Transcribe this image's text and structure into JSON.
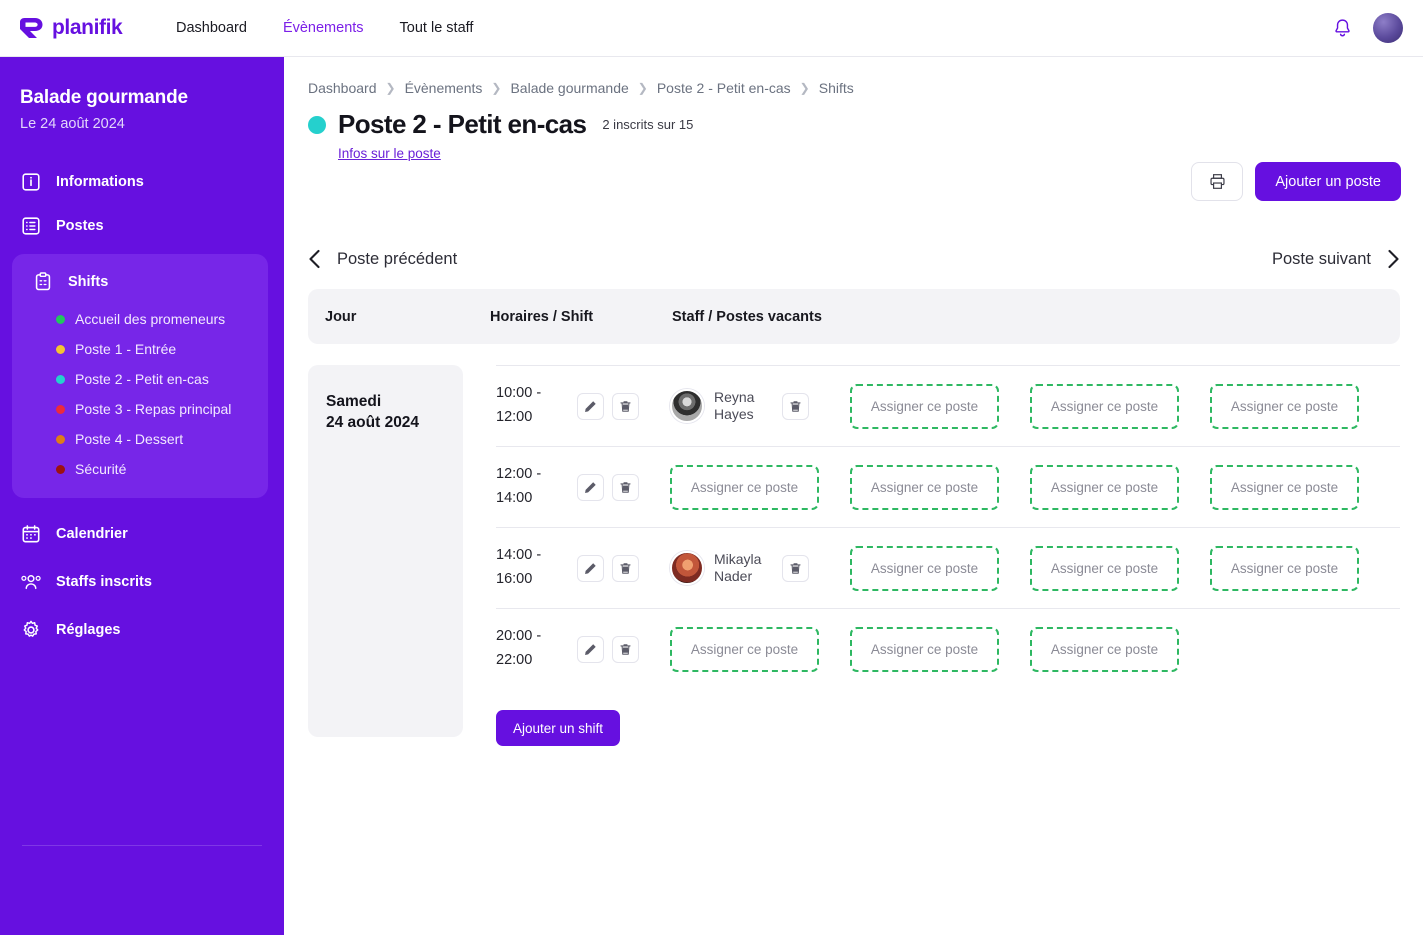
{
  "brand": {
    "name": "planifik"
  },
  "topnav": {
    "items": [
      {
        "label": "Dashboard",
        "active": false
      },
      {
        "label": "Évènements",
        "active": true
      },
      {
        "label": "Tout le staff",
        "active": false
      }
    ]
  },
  "sidebar": {
    "event_title": "Balade gourmande",
    "event_date": "Le 24 août 2024",
    "items": [
      {
        "label": "Informations",
        "icon": "info-icon"
      },
      {
        "label": "Postes",
        "icon": "list-icon"
      },
      {
        "label": "Shifts",
        "icon": "clipboard-icon",
        "active": true
      },
      {
        "label": "Calendrier",
        "icon": "calendar-icon"
      },
      {
        "label": "Staffs inscrits",
        "icon": "people-icon"
      },
      {
        "label": "Réglages",
        "icon": "gear-icon"
      }
    ],
    "shift_list": [
      {
        "label": "Accueil des promeneurs",
        "color": "#22c55e"
      },
      {
        "label": "Poste 1 - Entrée",
        "color": "#f5c332"
      },
      {
        "label": "Poste 2 - Petit en-cas",
        "color": "#25d0cd",
        "active": true
      },
      {
        "label": "Poste 3 - Repas principal",
        "color": "#ec2b3c"
      },
      {
        "label": "Poste 4 - Dessert",
        "color": "#df7c18"
      },
      {
        "label": "Sécurité",
        "color": "#9c1111"
      }
    ]
  },
  "breadcrumb": [
    "Dashboard",
    "Évènements",
    "Balade gourmande",
    "Poste 2 - Petit en-cas",
    "Shifts"
  ],
  "header": {
    "title": "Poste 2 - Petit en-cas",
    "dot_color": "#25d0cd",
    "inscrits": "2 inscrits sur 15",
    "infos_link": "Infos sur le poste",
    "print_label": "print-icon",
    "add_poste_label": "Ajouter un poste"
  },
  "poste_nav": {
    "prev": "Poste précédent",
    "next": "Poste suivant"
  },
  "table": {
    "columns": [
      "Jour",
      "Horaires / Shift",
      "Staff / Postes vacants"
    ],
    "day": {
      "name": "Samedi",
      "date": "24 août 2024"
    },
    "assign_label": "Assigner ce poste",
    "add_shift_label": "Ajouter un shift",
    "rows": [
      {
        "time_start": "10:00 -",
        "time_end": "12:00",
        "staff": [
          {
            "name_line1": "Reyna",
            "name_line2": "Hayes",
            "avatar": "grayscale-portrait"
          }
        ],
        "vacant": 3
      },
      {
        "time_start": "12:00 -",
        "time_end": "14:00",
        "staff": [],
        "vacant": 4
      },
      {
        "time_start": "14:00 -",
        "time_end": "16:00",
        "staff": [
          {
            "name_line1": "Mikayla",
            "name_line2": "Nader",
            "avatar": "warm-portrait"
          }
        ],
        "vacant": 3
      },
      {
        "time_start": "20:00 -",
        "time_end": "22:00",
        "staff": [],
        "vacant": 3
      }
    ]
  },
  "colors": {
    "brand_purple": "#6610e0",
    "sidebar_active": "#7726e8",
    "assign_border": "#2eb862",
    "accent_link": "#6b21d8"
  }
}
